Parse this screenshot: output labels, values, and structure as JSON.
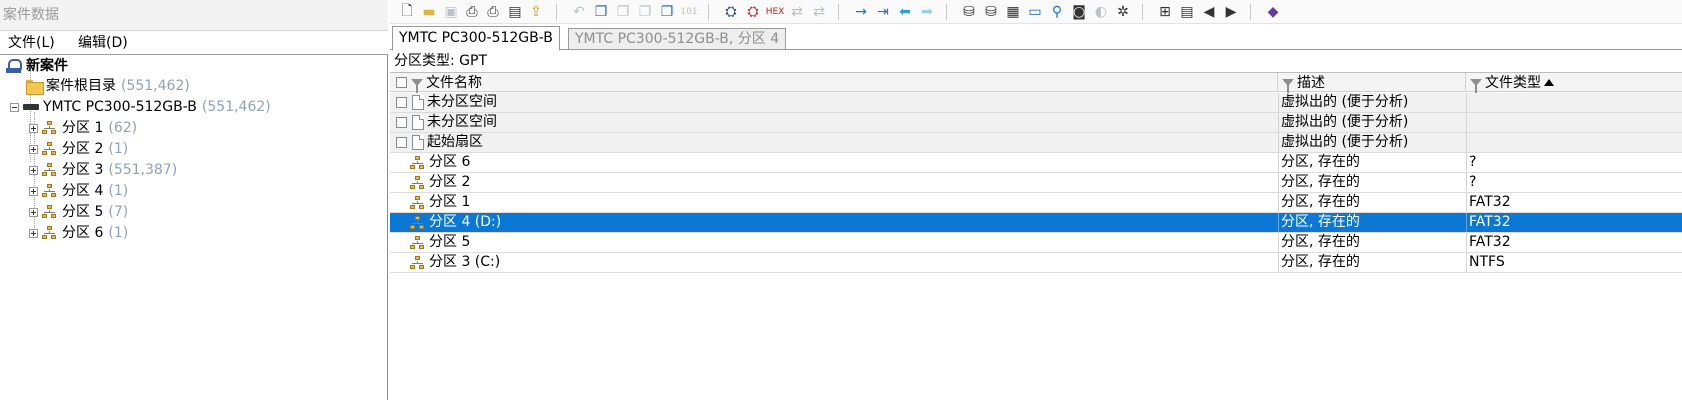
{
  "left_panel": {
    "title": "案件数据",
    "menu": [
      "文件(L)",
      "编辑(D)"
    ],
    "tree": {
      "root": {
        "label": "新案件"
      },
      "case_root": {
        "label": "案件根目录",
        "count": "(551,462)"
      },
      "disk": {
        "label": "YMTC PC300-512GB-B",
        "count": "(551,462)"
      },
      "partitions": [
        {
          "label": "分区 1",
          "count": "(62)"
        },
        {
          "label": "分区 2",
          "count": "(1)"
        },
        {
          "label": "分区 3",
          "count": "(551,387)"
        },
        {
          "label": "分区 4",
          "count": "(1)"
        },
        {
          "label": "分区 5",
          "count": "(7)"
        },
        {
          "label": "分区 6",
          "count": "(1)"
        }
      ]
    }
  },
  "right_panel": {
    "tabs": [
      {
        "label": "YMTC PC300-512GB-B",
        "active": true
      },
      {
        "label": "YMTC PC300-512GB-B, 分区 4",
        "active": false
      }
    ],
    "partition_type": "分区类型: GPT",
    "columns": {
      "name": "文件名称",
      "desc": "描述",
      "type": "文件类型"
    },
    "rows": [
      {
        "name": "未分区空间",
        "desc": "虚拟出的 (便于分析)",
        "type": "",
        "kind": "virtual"
      },
      {
        "name": "未分区空间",
        "desc": "虚拟出的 (便于分析)",
        "type": "",
        "kind": "virtual"
      },
      {
        "name": "起始扇区",
        "desc": "虚拟出的 (便于分析)",
        "type": "",
        "kind": "virtual"
      },
      {
        "name": "分区 6",
        "desc": "分区, 存在的",
        "type": "?",
        "kind": "partition"
      },
      {
        "name": "分区 2",
        "desc": "分区, 存在的",
        "type": "?",
        "kind": "partition"
      },
      {
        "name": "分区 1",
        "desc": "分区, 存在的",
        "type": "FAT32",
        "kind": "partition"
      },
      {
        "name": "分区 4 (D:)",
        "desc": "分区, 存在的",
        "type": "FAT32",
        "kind": "partition",
        "selected": true
      },
      {
        "name": "分区 5",
        "desc": "分区, 存在的",
        "type": "FAT32",
        "kind": "partition"
      },
      {
        "name": "分区 3 (C:)",
        "desc": "分区, 存在的",
        "type": "NTFS",
        "kind": "partition"
      }
    ]
  },
  "toolbar_icons": [
    "new-icon",
    "open-folder-icon",
    "save-icon",
    "print-icon",
    "printer-icon",
    "properties-icon",
    "export-icon",
    "undo-icon",
    "copy-icon",
    "paste-icon",
    "copy-sectors-icon",
    "paste-special-icon",
    "binary-icon",
    "find-icon",
    "find-text-icon",
    "find-hex-icon",
    "replace-icon",
    "replace-hex-icon",
    "goto-offset-icon",
    "goto-sector-icon",
    "back-icon",
    "forward-icon",
    "open-disk-icon",
    "open-image-icon",
    "ram-icon",
    "calculator-icon",
    "search-icon",
    "camera-icon",
    "snapshot-icon",
    "gear-icon",
    "view-icon",
    "table-icon",
    "prev-icon",
    "next-icon",
    "book-icon"
  ],
  "colors": {
    "selection": "#0a78d4",
    "count_text": "#8fa2b8"
  }
}
